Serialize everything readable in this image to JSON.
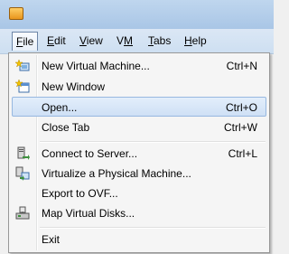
{
  "menubar": {
    "items": [
      {
        "label": "File",
        "mnemonic": "F",
        "rest": "ile"
      },
      {
        "label": "Edit",
        "mnemonic": "E",
        "rest": "dit"
      },
      {
        "label": "View",
        "mnemonic": "V",
        "rest": "iew"
      },
      {
        "label": "VM",
        "mnemonic": "M",
        "pre": "V"
      },
      {
        "label": "Tabs",
        "mnemonic": "T",
        "rest": "abs"
      },
      {
        "label": "Help",
        "mnemonic": "H",
        "rest": "elp"
      }
    ]
  },
  "file_menu": {
    "items": [
      {
        "label": "New Virtual Machine...",
        "shortcut": "Ctrl+N",
        "icon": "new-vm-icon"
      },
      {
        "label": "New Window",
        "shortcut": "",
        "icon": "new-window-icon"
      },
      {
        "label": "Open...",
        "shortcut": "Ctrl+O",
        "highlighted": true
      },
      {
        "label": "Close Tab",
        "shortcut": "Ctrl+W"
      },
      {
        "label": "Connect to Server...",
        "shortcut": "Ctrl+L",
        "icon": "connect-server-icon"
      },
      {
        "label": "Virtualize a Physical Machine...",
        "shortcut": "",
        "icon": "virtualize-icon"
      },
      {
        "label": "Export to OVF...",
        "shortcut": ""
      },
      {
        "label": "Map Virtual Disks...",
        "shortcut": "",
        "icon": "map-disks-icon"
      },
      {
        "label": "Exit",
        "shortcut": ""
      }
    ]
  }
}
